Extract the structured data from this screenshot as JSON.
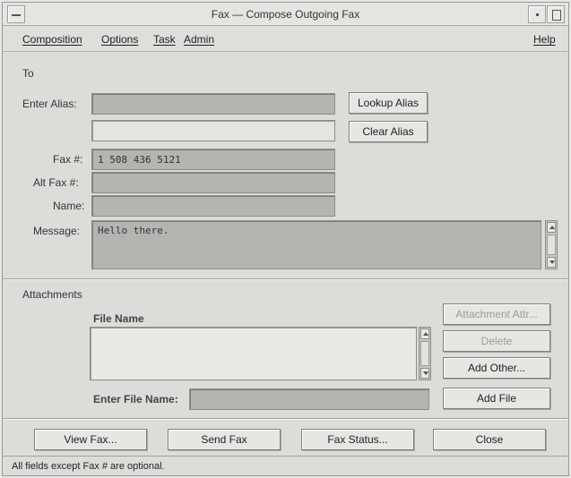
{
  "window": {
    "title": "Fax — Compose Outgoing Fax"
  },
  "menubar": {
    "items": [
      "Composition",
      "Options",
      "Task",
      "Admin"
    ],
    "help": "Help"
  },
  "to_section": {
    "heading": "To",
    "enter_alias_label": "Enter Alias:",
    "enter_alias_value": "",
    "alias_second_value": "",
    "lookup_alias_button": "Lookup Alias",
    "clear_alias_button": "Clear Alias",
    "fax_label": "Fax #:",
    "fax_value": "1 508 436 5121",
    "alt_fax_label": "Alt Fax #:",
    "alt_fax_value": "",
    "name_label": "Name:",
    "name_value": "",
    "message_label": "Message:",
    "message_value": "Hello there."
  },
  "attachments": {
    "heading": "Attachments",
    "file_name_header": "File Name",
    "files": [],
    "attachment_attr_button": "Attachment Attr...",
    "delete_button": "Delete",
    "add_other_button": "Add Other...",
    "enter_file_name_label": "Enter File Name:",
    "enter_file_name_value": "",
    "add_file_button": "Add File"
  },
  "actions": {
    "view_fax": "View Fax...",
    "send_fax": "Send Fax",
    "fax_status": "Fax Status...",
    "close": "Close"
  },
  "status": "All fields except Fax # are optional."
}
